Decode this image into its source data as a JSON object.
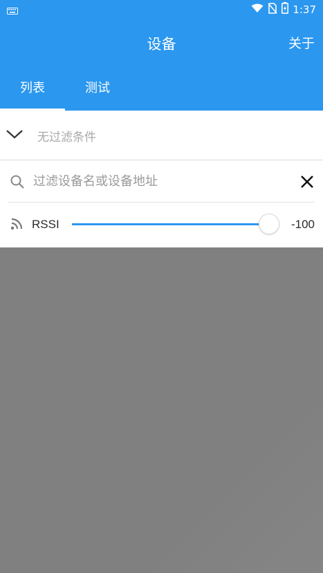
{
  "status_bar": {
    "time": "1:37",
    "icons": [
      "keyboard-icon",
      "wifi-icon",
      "no-sim-icon",
      "battery-charging-icon"
    ]
  },
  "app_bar": {
    "title": "设备",
    "about_label": "关于"
  },
  "tabs": [
    {
      "label": "列表",
      "active": true
    },
    {
      "label": "测试",
      "active": false
    }
  ],
  "filter": {
    "summary": "无过滤条件",
    "search": {
      "placeholder": "过滤设备名或设备地址",
      "value": ""
    },
    "rssi": {
      "label": "RSSI",
      "value_text": "-100",
      "slider_fraction": 1.0
    }
  },
  "colors": {
    "primary": "#2b97ef",
    "background_list": "#808080",
    "panel": "#ffffff"
  }
}
